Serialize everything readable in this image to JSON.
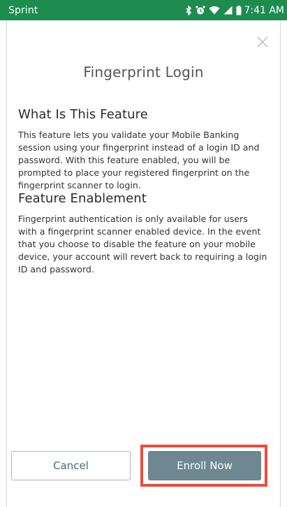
{
  "status_bar": {
    "carrier": "Sprint",
    "time": "7:41 AM",
    "icons": [
      "bluetooth-icon",
      "alarm-icon",
      "wifi-icon",
      "signal-icon",
      "battery-icon"
    ],
    "background_color": "#1e8c4e"
  },
  "dialog": {
    "title": "Fingerprint Login",
    "close_icon": "close-icon"
  },
  "sections": [
    {
      "heading": "What Is This Feature",
      "body": "This feature lets you validate your Mobile Banking session using your fingerprint instead of a login ID and password. With this feature enabled, you will be prompted to place your registered fingerprint on the fingerprint scanner to login."
    },
    {
      "heading": "Feature Enablement",
      "body": "Fingerprint authentication is only available for users with a fingerprint scanner enabled device. In the event that you choose to disable the feature on your mobile device, your account will revert back to requiring a login ID and password."
    }
  ],
  "actions": {
    "cancel_label": "Cancel",
    "enroll_label": "Enroll Now",
    "enroll_color": "#6e8791",
    "highlight_color": "#f04a3a"
  }
}
